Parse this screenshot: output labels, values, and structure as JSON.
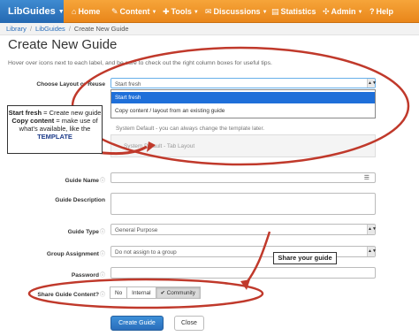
{
  "nav": {
    "brand": "LibGuides",
    "items": [
      {
        "icon": "home-icon",
        "glyph": "⌂",
        "label": "Home",
        "caret": false
      },
      {
        "icon": "content-icon",
        "glyph": "✎",
        "label": "Content",
        "caret": true
      },
      {
        "icon": "tools-icon",
        "glyph": "✚",
        "label": "Tools",
        "caret": true
      },
      {
        "icon": "discussions-icon",
        "glyph": "✉",
        "label": "Discussions",
        "caret": true
      },
      {
        "icon": "statistics-icon",
        "glyph": "▤",
        "label": "Statistics",
        "caret": false
      },
      {
        "icon": "admin-icon",
        "glyph": "✣",
        "label": "Admin",
        "caret": true
      },
      {
        "icon": "help-icon",
        "glyph": "?",
        "label": "Help",
        "caret": false
      }
    ]
  },
  "breadcrumb": {
    "items": [
      "Library",
      "LibGuides",
      "Create New Guide"
    ]
  },
  "page_title": "Create New Guide",
  "intro": "Hover over  icons next to each label, and be sure to check out the right column boxes for useful tips.",
  "form": {
    "layout_label": "Choose Layout or Reuse",
    "layout_value": "Start fresh",
    "layout_options": [
      "Start fresh",
      "Copy content / layout from an existing guide"
    ],
    "template_note": "System Default - you can always change the template later.",
    "template_value": "System Default - Tab Layout",
    "guide_name_label": "Guide Name",
    "guide_description_label": "Guide Description",
    "guide_type_label": "Guide Type",
    "guide_type_value": "General Purpose",
    "group_label": "Group Assignment",
    "group_value": "Do not assign to a group",
    "password_label": "Password",
    "share_label": "Share Guide Content?",
    "share_options": [
      "No",
      "Internal",
      "✔ Community"
    ],
    "share_selected": "Community",
    "create_button": "Create Guide",
    "close_button": "Close"
  },
  "annotations": {
    "start_fresh_term": "Start fresh",
    "start_fresh_def": " = Create new guide",
    "copy_term": "Copy content",
    "copy_def": " = make use of what's available, like the ",
    "template_word": "TEMPLATE",
    "share_callout": "Share your guide",
    "color": "#c0392b"
  }
}
